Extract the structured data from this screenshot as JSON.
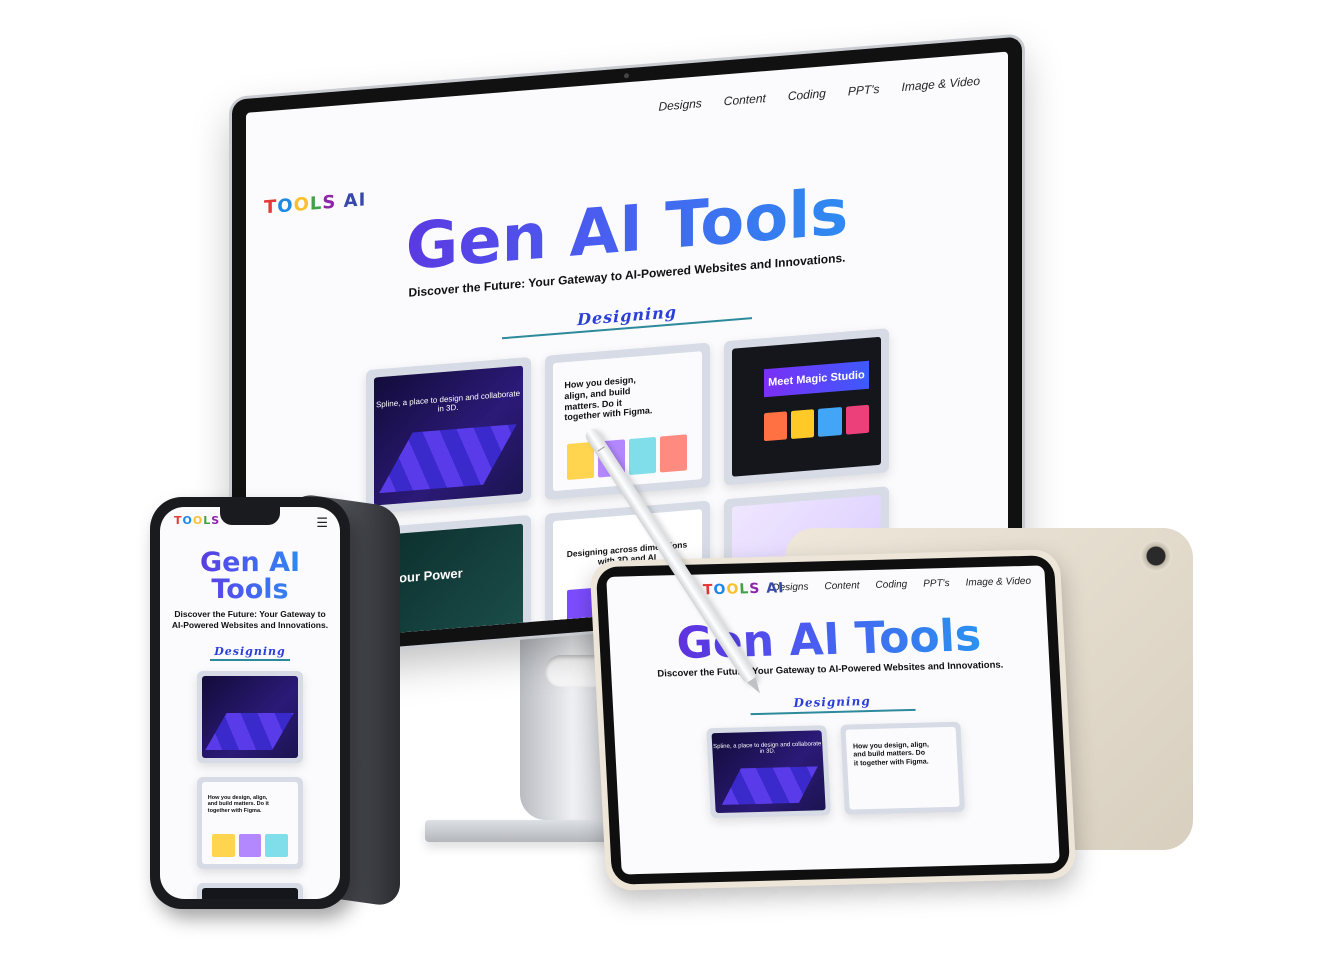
{
  "site": {
    "logo": "TOOLS AI",
    "nav": [
      "Designs",
      "Content",
      "Coding",
      "PPT's",
      "Image & Video"
    ],
    "hero_title": "Gen AI Tools",
    "hero_subtitle": "Discover the Future: Your Gateway to AI-Powered Websites and Innovations.",
    "section_title": "Designing",
    "menu_glyph": "☰"
  },
  "cards": {
    "spline": "Spline, a place to design and collaborate in 3D.",
    "figma": "How you design, align, and build matters. Do it together with Figma.",
    "canva": "Meet Magic Studio",
    "vectary": "Designing across dimensions with 3D and AI",
    "power": "Your Power"
  },
  "colors": {
    "title_gradient_start": "#6a1bd6",
    "title_gradient_end": "#1ea7f0",
    "section_title": "#2b3fd8",
    "section_rule": "#2d8a9a",
    "card_frame": "#d6dbe5"
  }
}
